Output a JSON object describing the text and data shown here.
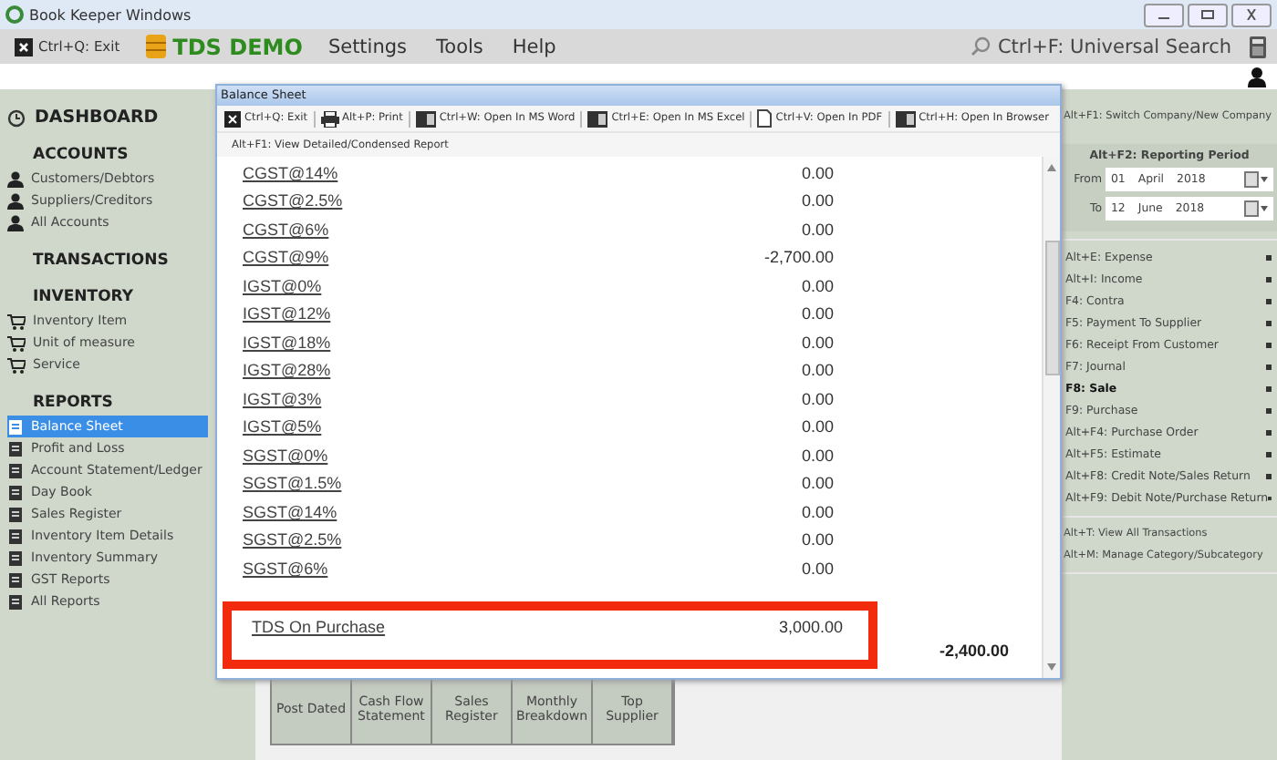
{
  "window": {
    "title": "Book Keeper Windows"
  },
  "menu_bar": {
    "exit": "Ctrl+Q: Exit",
    "company": "TDS DEMO",
    "items": [
      "Settings",
      "Tools",
      "Help"
    ],
    "search": "Ctrl+F: Universal Search"
  },
  "sidebar": {
    "dashboard": "DASHBOARD",
    "sections": [
      {
        "title": "ACCOUNTS",
        "items": [
          {
            "label": "Customers/Debtors",
            "selected": false
          },
          {
            "label": "Suppliers/Creditors",
            "selected": false
          },
          {
            "label": "All Accounts",
            "selected": false
          }
        ]
      },
      {
        "title": "TRANSACTIONS"
      },
      {
        "title": "INVENTORY",
        "items": [
          {
            "label": "Inventory Item",
            "selected": false
          },
          {
            "label": "Unit of measure",
            "selected": false
          },
          {
            "label": "Service",
            "selected": false
          }
        ]
      },
      {
        "title": "REPORTS",
        "items": [
          {
            "label": "Balance Sheet",
            "selected": true
          },
          {
            "label": "Profit and Loss",
            "selected": false
          },
          {
            "label": "Account Statement/Ledger",
            "selected": false
          },
          {
            "label": "Day Book",
            "selected": false
          },
          {
            "label": "Sales Register",
            "selected": false
          },
          {
            "label": "Inventory Item Details",
            "selected": false
          },
          {
            "label": "Inventory Summary",
            "selected": false
          },
          {
            "label": "GST Reports",
            "selected": false
          },
          {
            "label": "All Reports",
            "selected": false
          }
        ]
      }
    ]
  },
  "report_tiles": [
    "Post Dated",
    "Cash Flow Statement",
    "Sales Register",
    "Monthly Breakdown",
    "Top Supplier"
  ],
  "dialog": {
    "title": "Balance Sheet",
    "toolbar": [
      "Ctrl+Q: Exit",
      "Alt+P: Print",
      "Ctrl+W: Open In MS Word",
      "Ctrl+E: Open In MS Excel",
      "Ctrl+V: Open In PDF",
      "Ctrl+H: Open In Browser"
    ],
    "toolbar_2": "Alt+F1: View Detailed/Condensed Report",
    "rows": [
      {
        "name": "CGST@14%",
        "value": "0.00"
      },
      {
        "name": "CGST@2.5%",
        "value": "0.00"
      },
      {
        "name": "CGST@6%",
        "value": "0.00"
      },
      {
        "name": "CGST@9%",
        "value": "-2,700.00"
      },
      {
        "name": "IGST@0%",
        "value": "0.00"
      },
      {
        "name": "IGST@12%",
        "value": "0.00"
      },
      {
        "name": "IGST@18%",
        "value": "0.00"
      },
      {
        "name": "IGST@28%",
        "value": "0.00"
      },
      {
        "name": "IGST@3%",
        "value": "0.00"
      },
      {
        "name": "IGST@5%",
        "value": "0.00"
      },
      {
        "name": "SGST@0%",
        "value": "0.00"
      },
      {
        "name": "SGST@1.5%",
        "value": "0.00"
      },
      {
        "name": "SGST@14%",
        "value": "0.00"
      },
      {
        "name": "SGST@2.5%",
        "value": "0.00"
      },
      {
        "name": "SGST@6%",
        "value": "0.00"
      }
    ],
    "highlighted_row": {
      "name": "TDS On Purchase",
      "value": "3,000.00"
    },
    "total": "-2,400.00"
  },
  "right_panel": {
    "switch_company": "Alt+F1: Switch Company/New Company",
    "period_title": "Alt+F2: Reporting Period",
    "dates": [
      {
        "label": "From",
        "day": "01",
        "month": "April",
        "year": "2018"
      },
      {
        "label": "To",
        "day": "12",
        "month": "June",
        "year": "2018"
      }
    ],
    "transactions": [
      {
        "label": "Alt+E: Expense",
        "selected": false
      },
      {
        "label": "Alt+I: Income",
        "selected": false
      },
      {
        "label": "F4: Contra",
        "selected": false
      },
      {
        "label": "F5: Payment To Supplier",
        "selected": false
      },
      {
        "label": "F6: Receipt From Customer",
        "selected": false
      },
      {
        "label": "F7: Journal",
        "selected": false
      },
      {
        "label": "F8: Sale",
        "selected": true
      },
      {
        "label": "F9: Purchase",
        "selected": false
      },
      {
        "label": "Alt+F4: Purchase Order",
        "selected": false
      },
      {
        "label": "Alt+F5: Estimate",
        "selected": false
      },
      {
        "label": "Alt+F8: Credit Note/Sales Return",
        "selected": false
      },
      {
        "label": "Alt+F9: Debit Note/Purchase Return",
        "selected": false
      }
    ],
    "links": [
      "Alt+T: View All Transactions",
      "Alt+M: Manage Category/Subcategory"
    ]
  }
}
